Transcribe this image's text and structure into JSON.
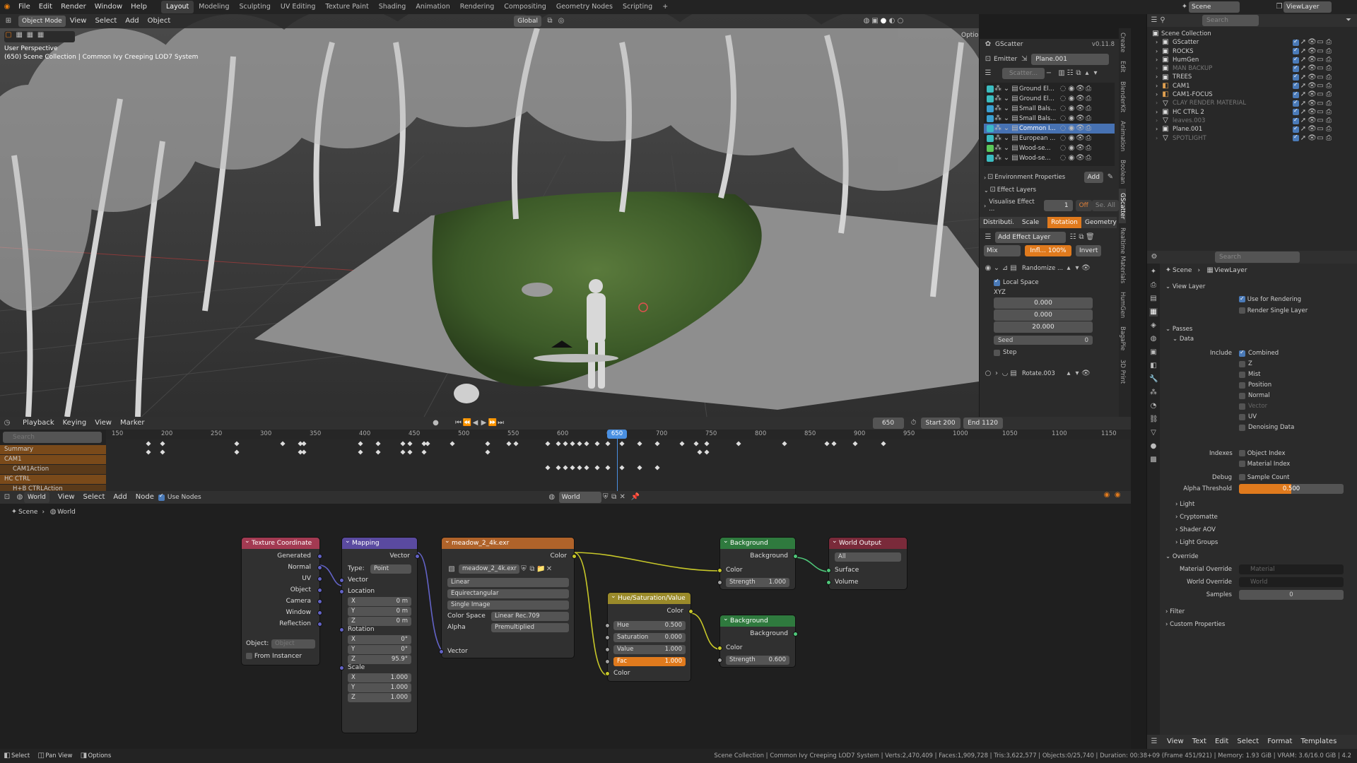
{
  "topbar": {
    "menus": [
      "File",
      "Edit",
      "Render",
      "Window",
      "Help"
    ],
    "workspaces": [
      "Layout",
      "Modeling",
      "Sculpting",
      "UV Editing",
      "Texture Paint",
      "Shading",
      "Animation",
      "Rendering",
      "Compositing",
      "Geometry Nodes",
      "Scripting"
    ],
    "active_workspace": "Layout",
    "scene": "Scene",
    "view_layer": "ViewLayer"
  },
  "viewport": {
    "mode": "Object Mode",
    "menus": [
      "View",
      "Select",
      "Add",
      "Object"
    ],
    "transform": "Global",
    "options": "Options",
    "info_line1": "User Perspective",
    "info_line2": "(650) Scene Collection | Common Ivy Creeping LOD7 System"
  },
  "gscatter": {
    "title": "GScatter",
    "version": "v0.11.8",
    "emitter_label": "Emitter",
    "emitter_value": "Plane.001",
    "scatter_label": "Scatter...",
    "layers": [
      {
        "name": "Ground El...",
        "color": "#3bbcc0"
      },
      {
        "name": "Ground El...",
        "color": "#3bbcc0"
      },
      {
        "name": "Small Bals...",
        "color": "#3aa0d0"
      },
      {
        "name": "Small Bals...",
        "color": "#3aa0d0"
      },
      {
        "name": "Common I...",
        "color": "#3ab8c8"
      },
      {
        "name": "European ...",
        "color": "#3bbcc0"
      },
      {
        "name": "Wood-se...",
        "color": "#5ac85a"
      },
      {
        "name": "Wood-se...",
        "color": "#3bbcc0"
      }
    ],
    "environment_properties": "Environment Properties",
    "add": "Add",
    "effect_layers": "Effect Layers",
    "visualise_effect": "Visualise Effect ...",
    "visualise_value": "1",
    "off": "Off",
    "se_all": "Se. All",
    "tabs": [
      "Distributi...",
      "Scale",
      "Rotation",
      "Geometry"
    ],
    "active_tab": "Rotation",
    "add_effect_layer": "Add Effect Layer",
    "blend_mode": "Mix",
    "influence": "Infl... 100%",
    "invert": "Invert",
    "effect1_name": "Randomize ...",
    "local_space": "Local Space",
    "xyz_label": "XYZ",
    "xyz": [
      "0.000",
      "0.000",
      "20.000"
    ],
    "seed_label": "Seed",
    "seed_value": "0",
    "step": "Step",
    "effect2_name": "Rotate.003"
  },
  "side_tabs": [
    "Create",
    "Edit",
    "BlenderKit",
    "Animation",
    "Boolean",
    "GScatter",
    "Realtime Materials",
    "HumGen",
    "BagaPie",
    "3D Print"
  ],
  "outliner": {
    "search_placeholder": "Search",
    "root": "Scene Collection",
    "items": [
      {
        "name": "GScatter",
        "dim": false
      },
      {
        "name": "ROCKS",
        "dim": false
      },
      {
        "name": "HumGen",
        "dim": false
      },
      {
        "name": "MAN BACKUP",
        "dim": true
      },
      {
        "name": "TREES",
        "dim": false
      },
      {
        "name": "CAM1",
        "dim": false
      },
      {
        "name": "CAM1-FOCUS",
        "dim": false
      },
      {
        "name": "CLAY RENDER MATERIAL",
        "dim": true
      },
      {
        "name": "HC CTRL 2",
        "dim": false
      },
      {
        "name": "leaves.003",
        "dim": true
      },
      {
        "name": "Plane.001",
        "dim": false
      },
      {
        "name": "SPOTLIGHT",
        "dim": true
      }
    ]
  },
  "properties": {
    "search_placeholder": "Search",
    "breadcrumb_scene": "Scene",
    "breadcrumb_layer": "ViewLayer",
    "view_layer_panel": "View Layer",
    "use_for_rendering": "Use for Rendering",
    "render_single_layer": "Render Single Layer",
    "passes": "Passes",
    "data": "Data",
    "include_label": "Include",
    "include_items": [
      {
        "label": "Combined",
        "on": true,
        "dim": false
      },
      {
        "label": "Z",
        "on": false,
        "dim": false
      },
      {
        "label": "Mist",
        "on": false,
        "dim": false
      },
      {
        "label": "Position",
        "on": false,
        "dim": false
      },
      {
        "label": "Normal",
        "on": false,
        "dim": false
      },
      {
        "label": "Vector",
        "on": false,
        "dim": true
      },
      {
        "label": "UV",
        "on": false,
        "dim": false
      },
      {
        "label": "Denoising Data",
        "on": false,
        "dim": false
      }
    ],
    "indexes_label": "Indexes",
    "object_index": "Object Index",
    "material_index": "Material Index",
    "debug_label": "Debug",
    "sample_count": "Sample Count",
    "alpha_threshold_label": "Alpha Threshold",
    "alpha_threshold": "0.500",
    "alpha_threshold_fraction": 0.5,
    "light": "Light",
    "cryptomatte": "Cryptomatte",
    "shader_aov": "Shader AOV",
    "light_groups": "Light Groups",
    "override": "Override",
    "material_override_label": "Material Override",
    "material_placeholder": "Material",
    "world_override_label": "World Override",
    "world_placeholder": "World",
    "samples_label": "Samples",
    "samples_value": "0",
    "filter": "Filter",
    "custom_properties": "Custom Properties"
  },
  "timeline": {
    "menus": [
      "Playback",
      "Keying",
      "View",
      "Marker"
    ],
    "current_frame": "650",
    "start_label": "Start",
    "start": "200",
    "end_label": "End",
    "end": "1120",
    "search_placeholder": "Search",
    "ruler": [
      "150",
      "200",
      "250",
      "300",
      "350",
      "400",
      "450",
      "500",
      "550",
      "600",
      "650",
      "700",
      "750",
      "800",
      "850",
      "900",
      "950",
      "1000",
      "1050",
      "1100",
      "1150"
    ],
    "channels": [
      "Summary",
      "CAM1",
      "CAM1Action",
      "HC CTRL",
      "H+B CTRLAction"
    ]
  },
  "node_editor": {
    "type": "World",
    "menus": [
      "View",
      "Select",
      "Add",
      "Node"
    ],
    "use_nodes": "Use Nodes",
    "world_name": "World",
    "breadcrumb_scene": "Scene",
    "breadcrumb_world": "World",
    "tex_coord": {
      "title": "Texture Coordinate",
      "outputs": [
        "Generated",
        "Normal",
        "UV",
        "Object",
        "Camera",
        "Window",
        "Reflection"
      ],
      "object_label": "Object:",
      "object_placeholder": "Object",
      "from_instancer": "From Instancer"
    },
    "mapping": {
      "title": "Mapping",
      "vector_out": "Vector",
      "type_label": "Type:",
      "type_value": "Point",
      "vector_in": "Vector",
      "location": "Location",
      "loc": [
        {
          "axis": "X",
          "val": "0 m"
        },
        {
          "axis": "Y",
          "val": "0 m"
        },
        {
          "axis": "Z",
          "val": "0 m"
        }
      ],
      "rotation": "Rotation",
      "rot": [
        {
          "axis": "X",
          "val": "0°"
        },
        {
          "axis": "Y",
          "val": "0°"
        },
        {
          "axis": "Z",
          "val": "95.9°"
        }
      ],
      "scale": "Scale",
      "scl": [
        {
          "axis": "X",
          "val": "1.000"
        },
        {
          "axis": "Y",
          "val": "1.000"
        },
        {
          "axis": "Z",
          "val": "1.000"
        }
      ]
    },
    "env_tex": {
      "title": "meadow_2_4k.exr",
      "color_out": "Color",
      "image": "meadow_2_4k.exr",
      "interp": "Linear",
      "projection": "Equirectangular",
      "source": "Single Image",
      "color_space_label": "Color Space",
      "color_space": "Linear Rec.709",
      "alpha_label": "Alpha",
      "alpha": "Premultiplied",
      "vector_in": "Vector"
    },
    "hsv": {
      "title": "Hue/Saturation/Value",
      "color_out": "Color",
      "hue_label": "Hue",
      "hue": "0.500",
      "sat_label": "Saturation",
      "sat": "0.000",
      "val_label": "Value",
      "val": "1.000",
      "fac_label": "Fac",
      "fac": "1.000",
      "color_in": "Color"
    },
    "bg1": {
      "title": "Background",
      "out": "Background",
      "color": "Color",
      "strength_label": "Strength",
      "strength": "1.000"
    },
    "bg2": {
      "title": "Background",
      "out": "Background",
      "color": "Color",
      "strength_label": "Strength",
      "strength": "0.600"
    },
    "output": {
      "title": "World Output",
      "target": "All",
      "surface": "Surface",
      "volume": "Volume"
    }
  },
  "text_editor": {
    "menus": [
      "View",
      "Text",
      "Edit",
      "Select",
      "Format",
      "Templates"
    ]
  },
  "statusbar": {
    "select": "Select",
    "pan": "Pan View",
    "options": "Options",
    "stats": "Scene Collection | Common Ivy Creeping LOD7 System | Verts:2,470,409 | Faces:1,909,728 | Tris:3,622,577 | Objects:0/25,740 | Duration: 00:38+09 (Frame 451/921) | Memory: 1.93 GiB | VRAM: 3.6/16.0 GiB | 4.2"
  }
}
